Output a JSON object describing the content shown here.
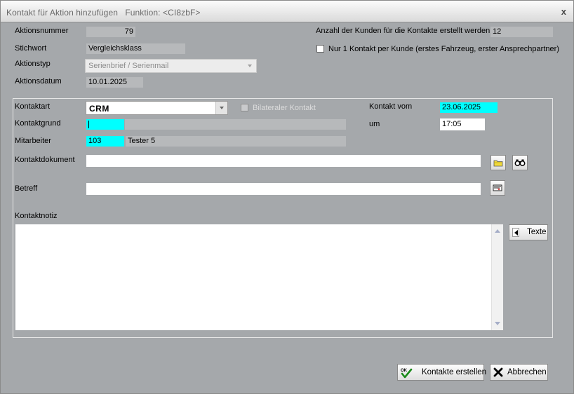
{
  "window": {
    "title": "Kontakt für Aktion hinzufügen",
    "function": "Funktion: <CI8zbF>",
    "close_glyph": "x"
  },
  "aktion": {
    "nummer_label": "Aktionsnummer",
    "nummer_value": "79",
    "stichwort_label": "Stichwort",
    "stichwort_value": "Vergleichsklass",
    "typ_label": "Aktionstyp",
    "typ_value": "Serienbrief / Serienmail",
    "datum_label": "Aktionsdatum",
    "datum_value": "10.01.2025",
    "anzahl_label": "Anzahl der Kunden für die Kontakte erstellt werden",
    "anzahl_value": "12",
    "nur1_label": "Nur 1 Kontakt per Kunde (erstes Fahrzeug, erster Ansprechpartner)",
    "nur1_checked": false
  },
  "kontakt": {
    "art_label": "Kontaktart",
    "art_value": "CRM",
    "bilateral_label": "Bilateraler Kontakt",
    "bilateral_checked": false,
    "vom_label": "Kontakt vom",
    "vom_value": "23.06.2025",
    "grund_label": "Kontaktgrund",
    "grund_value": "",
    "um_label": "um",
    "um_value": "17:05",
    "mitarbeiter_label": "Mitarbeiter",
    "mitarbeiter_id": "103",
    "mitarbeiter_name": "Tester 5",
    "dokument_label": "Kontaktdokument",
    "dokument_value": "",
    "betreff_label": "Betreff",
    "betreff_value": "",
    "notiz_label": "Kontaktnotiz",
    "notiz_value": "",
    "texte_button": "Texte"
  },
  "footer": {
    "ok_icon_text": "OK",
    "create_button": "Kontakte erstellen",
    "cancel_button": "Abbrechen"
  },
  "icons": {
    "folder": "folder-icon",
    "binoculars": "binoculars-icon",
    "subject_picker": "list-picker-icon",
    "texte_arrow": "arrow-left-icon",
    "ok": "checkmark-icon",
    "cancel": "x-icon"
  },
  "colors": {
    "window_bg": "#a5a8ab",
    "required_field": "#00ffff",
    "readonly_field": "#b7b9bb"
  }
}
